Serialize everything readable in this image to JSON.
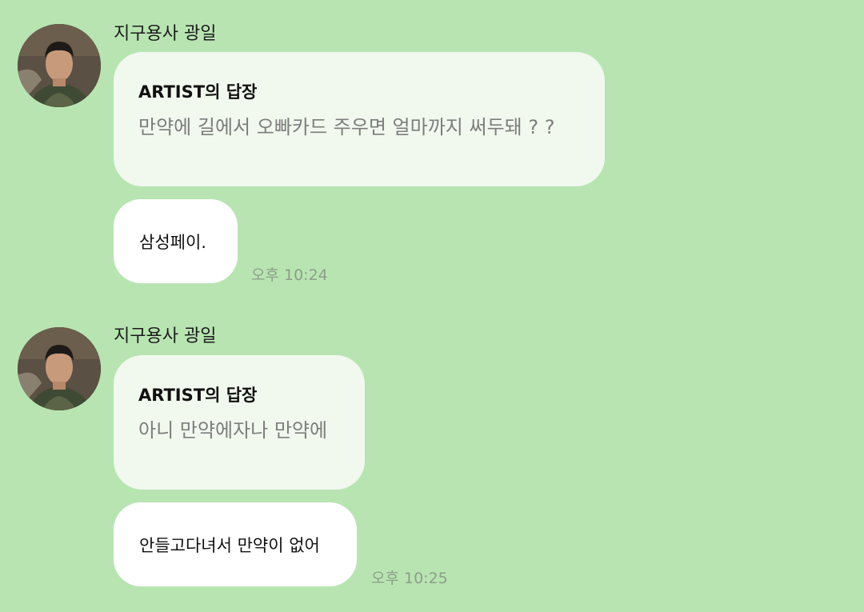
{
  "messages": [
    {
      "sender": "지구용사 광일",
      "reply_title": "ARTIST의 답장",
      "reply_text": "만약에 길에서 오빠카드 주우면 얼마까지 써두돼 ? ?",
      "message": "삼성페이.",
      "time": "오후 10:24"
    },
    {
      "sender": "지구용사 광일",
      "reply_title": "ARTIST의 답장",
      "reply_text": "아니 만약에자나 만약에",
      "message": "안들고다녀서 만약이 없어",
      "time": "오후 10:25"
    }
  ],
  "colors": {
    "background": "#b8e4b2",
    "reply_bubble": "#f1f8ee",
    "message_bubble": "#ffffff",
    "time_text": "#8b9f88"
  },
  "icons": {
    "avatar": "profile-photo"
  }
}
